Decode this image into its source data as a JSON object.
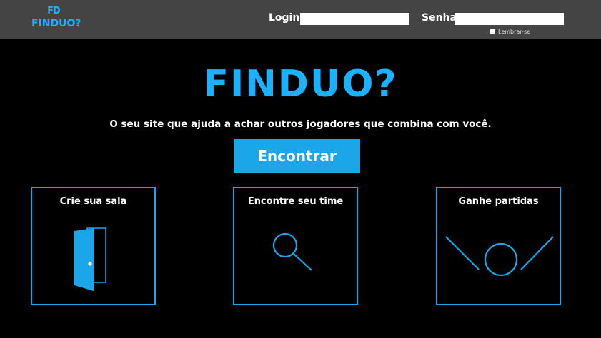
{
  "header": {
    "logo_mark": "FD",
    "logo_word": "FINDUO?",
    "login_label": "Login",
    "login_value": "",
    "senha_label": "Senha",
    "senha_value": "",
    "remember_label": "Lembrar-se"
  },
  "hero": {
    "title": "FINDUO?",
    "tagline": "O seu site que ajuda a achar outros jogadores que combina com você.",
    "cta_label": "Encontrar"
  },
  "cards": [
    {
      "title": "Crie sua sala",
      "icon": "door-icon"
    },
    {
      "title": "Encontre seu time",
      "icon": "search-icon"
    },
    {
      "title": "Ganhe partidas",
      "icon": "trophy-icon"
    }
  ],
  "colors": {
    "accent": "#1aa6e8",
    "header_bg": "#444444",
    "background": "#000000"
  }
}
